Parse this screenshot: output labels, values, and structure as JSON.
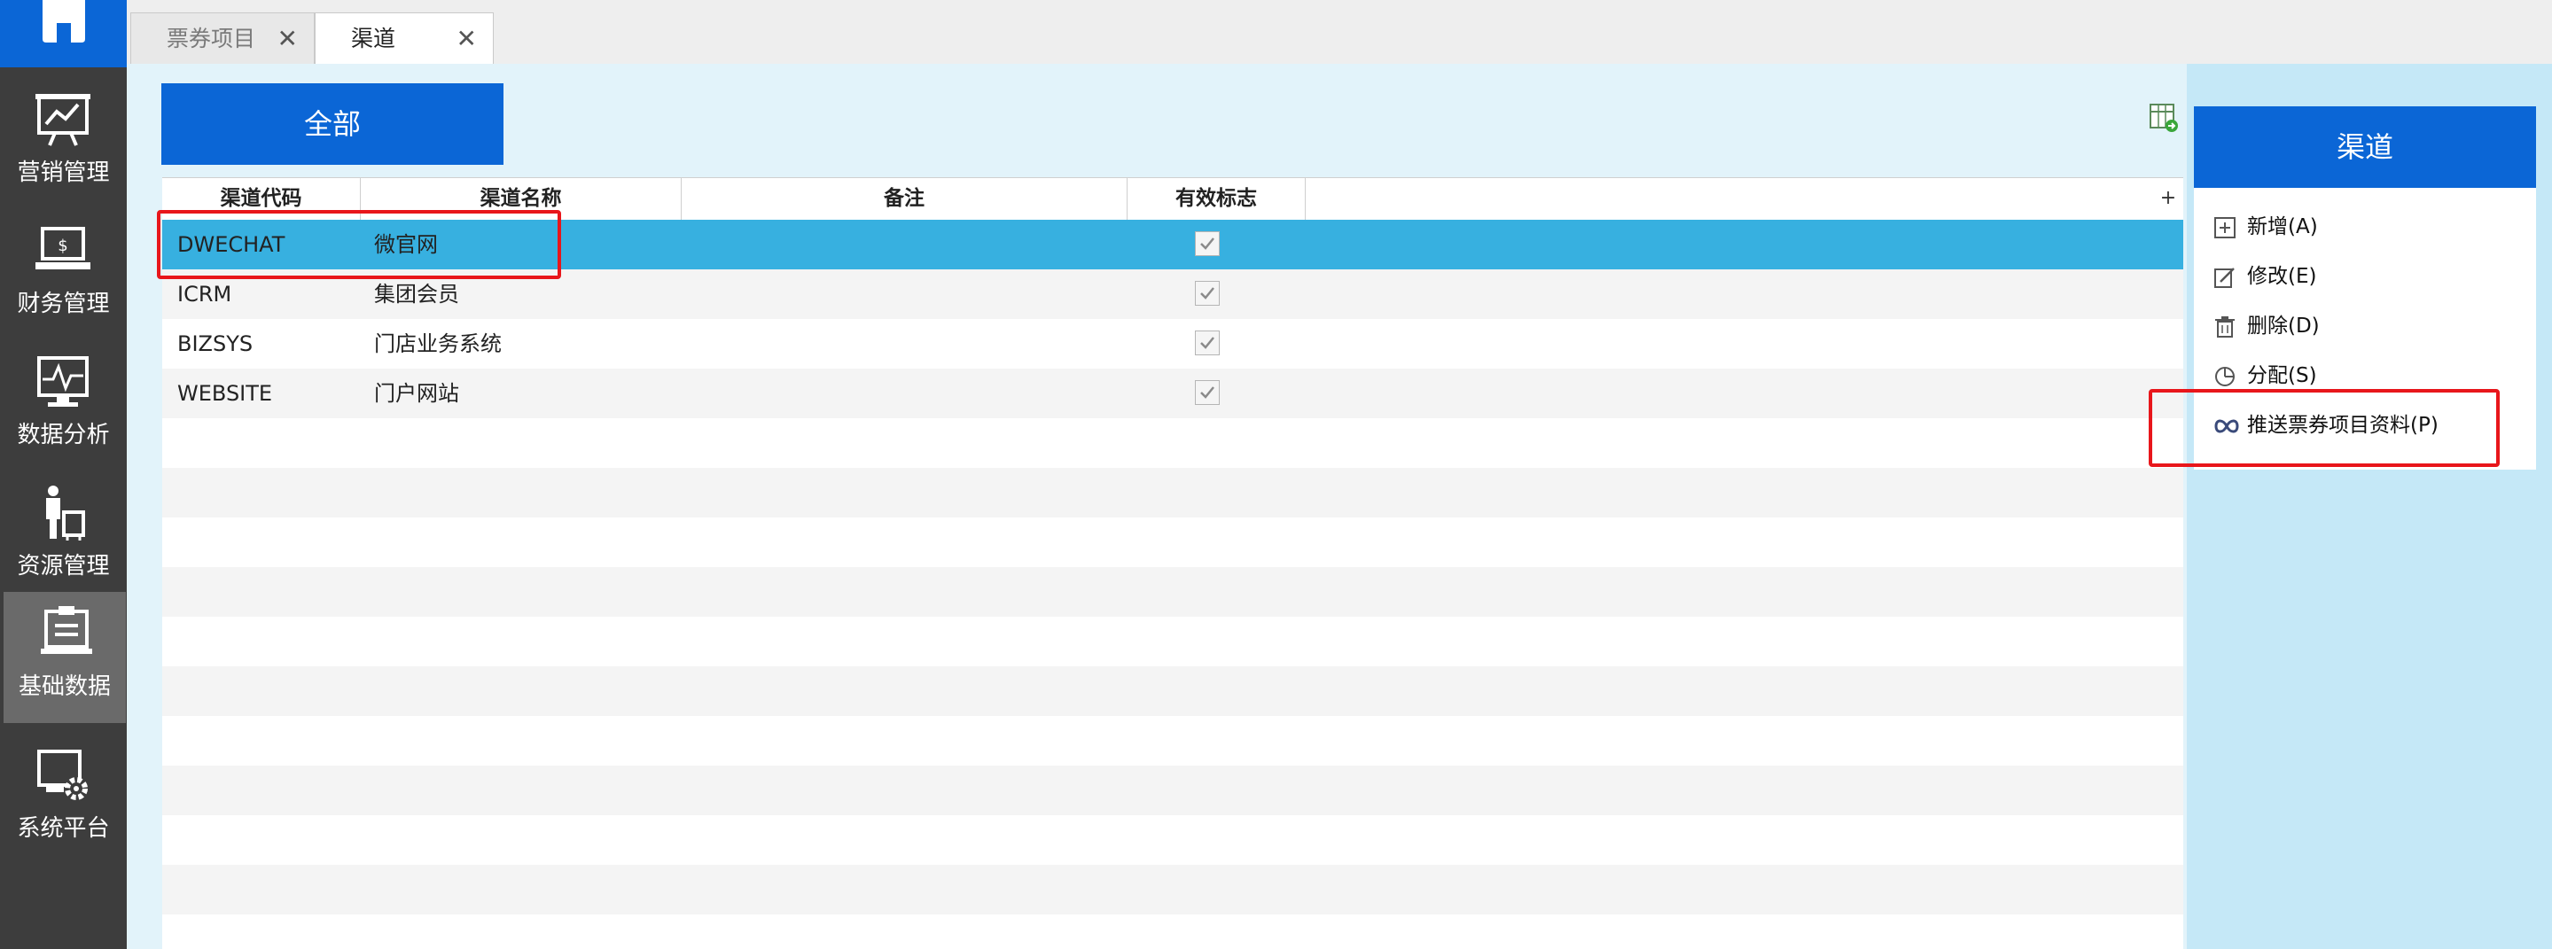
{
  "sidebar": {
    "items": [
      {
        "label": "营销管理",
        "icon": "marketing-chart-icon"
      },
      {
        "label": "财务管理",
        "icon": "finance-laptop-icon"
      },
      {
        "label": "数据分析",
        "icon": "data-analysis-icon"
      },
      {
        "label": "资源管理",
        "icon": "resource-person-icon"
      },
      {
        "label": "基础数据",
        "icon": "basic-data-clipboard-icon",
        "active": true
      },
      {
        "label": "系统平台",
        "icon": "system-gear-icon"
      }
    ]
  },
  "tabs": [
    {
      "label": "票券项目",
      "active": false
    },
    {
      "label": "渠道",
      "active": true
    }
  ],
  "toolbar": {
    "all_label": "全部"
  },
  "grid": {
    "columns": [
      "渠道代码",
      "渠道名称",
      "备注",
      "有效标志"
    ],
    "rows": [
      {
        "code": "DWECHAT",
        "name": "微官网",
        "remark": "",
        "valid": true,
        "selected": true
      },
      {
        "code": "ICRM",
        "name": "集团会员",
        "remark": "",
        "valid": true
      },
      {
        "code": "BIZSYS",
        "name": "门店业务系统",
        "remark": "",
        "valid": true
      },
      {
        "code": "WEBSITE",
        "name": "门户网站",
        "remark": "",
        "valid": true
      }
    ]
  },
  "panel": {
    "title": "渠道",
    "actions": [
      {
        "label": "新增(A)",
        "icon": "add-icon"
      },
      {
        "label": "修改(E)",
        "icon": "edit-icon"
      },
      {
        "label": "删除(D)",
        "icon": "delete-icon"
      },
      {
        "label": "分配(S)",
        "icon": "assign-pie-icon"
      },
      {
        "label": "推送票券项目资料(P)",
        "icon": "link-infinity-icon"
      }
    ]
  },
  "colors": {
    "accent": "#0b66d6",
    "selected_row": "#37b0e0",
    "sidebar_bg": "#3d3d3d",
    "highlight": "#e8161b"
  }
}
